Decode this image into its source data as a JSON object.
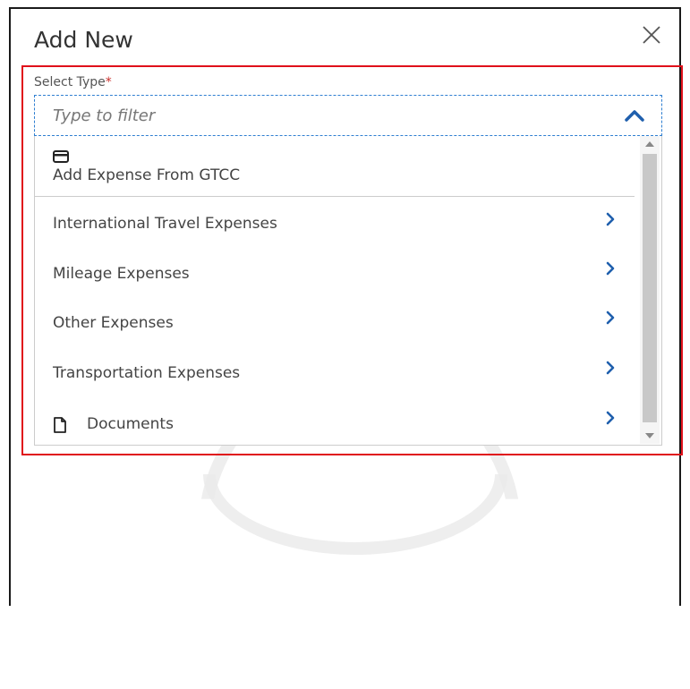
{
  "dialog": {
    "title": "Add New",
    "close_icon": "close-icon"
  },
  "field": {
    "label": "Select Type",
    "required_mark": "*",
    "placeholder": "Type to filter",
    "caret_icon": "chevron-up-icon"
  },
  "options": [
    {
      "label": "Add Expense From GTCC",
      "icon": "credit-card-icon"
    },
    {
      "label": "International Travel Expenses",
      "icon": "chevron-right-icon"
    },
    {
      "label": "Mileage Expenses",
      "icon": "chevron-right-icon"
    },
    {
      "label": "Other Expenses",
      "icon": "chevron-right-icon"
    },
    {
      "label": "Transportation Expenses",
      "icon": "chevron-right-icon"
    },
    {
      "label": "Documents",
      "icon": "document-icon"
    }
  ],
  "colors": {
    "accent": "#2f7fd1",
    "highlight": "#e0101a",
    "chevron": "#1f5fad"
  }
}
